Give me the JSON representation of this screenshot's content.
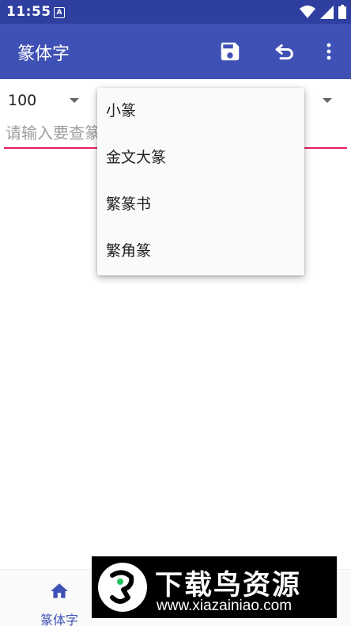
{
  "status_bar": {
    "time": "11:55",
    "notification_icon_label": "A",
    "icons": [
      "wifi-icon",
      "signal-icon",
      "battery-icon"
    ]
  },
  "app_bar": {
    "title": "篆体字",
    "actions": [
      "save-icon",
      "undo-icon",
      "more-vert-icon"
    ]
  },
  "size_spinner": {
    "value": "100"
  },
  "search": {
    "placeholder": "请输入要查篆",
    "value": ""
  },
  "font_dropdown": {
    "items": [
      {
        "label": "小篆"
      },
      {
        "label": "金文大篆"
      },
      {
        "label": "繁篆书"
      },
      {
        "label": "繁角篆"
      }
    ]
  },
  "bottom_nav": {
    "home_label": "篆体字",
    "home_icon": "home-icon"
  },
  "watermark": {
    "name": "下载鸟资源",
    "url": "www.xiazainiao.com"
  },
  "colors": {
    "status_bar": "#2f3f9f",
    "app_bar": "#3f51b5",
    "accent": "#e91e63",
    "nav_active": "#3f51b5"
  }
}
